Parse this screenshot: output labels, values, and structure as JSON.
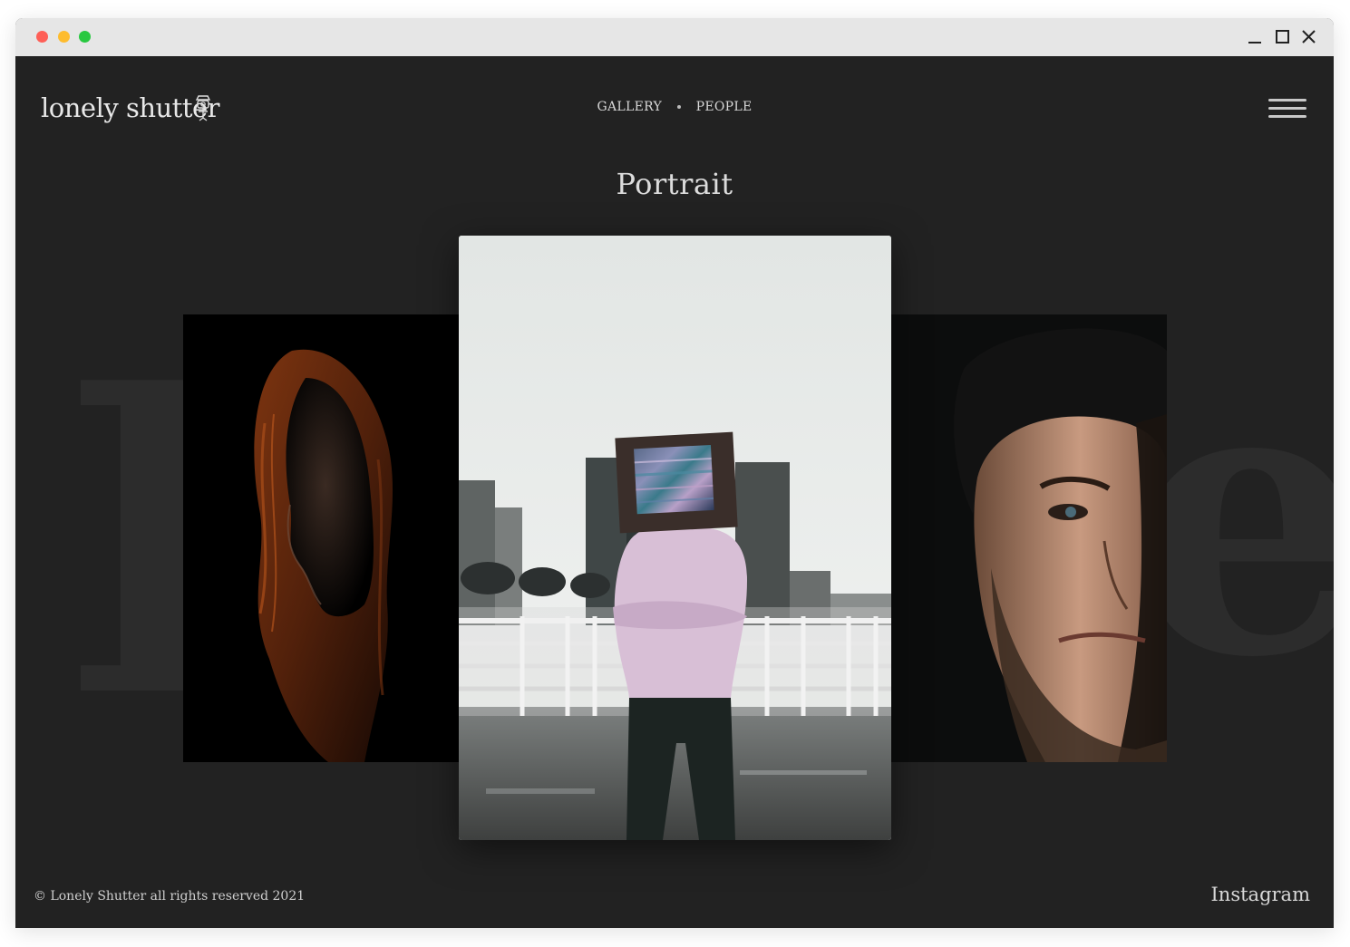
{
  "window": {
    "controls": [
      "close-dot",
      "minimize-dot",
      "zoom-dot"
    ],
    "icons": [
      "minimize-icon",
      "maximize-icon",
      "close-icon"
    ]
  },
  "header": {
    "logo_text": "lonely shutter",
    "logo_icon": "camera-figure-icon",
    "nav": [
      {
        "label": "GALLERY"
      },
      {
        "label": "PEOPLE"
      }
    ],
    "menu_icon": "hamburger-menu-icon"
  },
  "main": {
    "title": "Portrait",
    "photos": [
      {
        "subject": "woman-silhouette-photo"
      },
      {
        "subject": "tv-head-person-photo"
      },
      {
        "subject": "man-half-face-photo"
      }
    ]
  },
  "footer": {
    "copyright": "© Lonely Shutter all rights reserved 2021",
    "social_link": "Instagram"
  },
  "colors": {
    "background": "#222222",
    "text": "#dcdcdc",
    "titlebar": "#e6e6e6",
    "dot_red": "#fe5f57",
    "dot_yellow": "#febc2e",
    "dot_green": "#28c840"
  }
}
